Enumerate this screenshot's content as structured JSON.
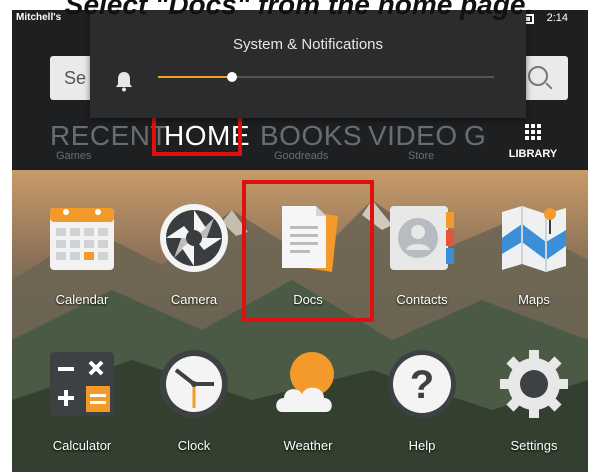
{
  "caption": "Select \"Docs\" from the home page.",
  "status_bar": {
    "owner_name": "Mitchell's",
    "time": "2:14"
  },
  "search": {
    "placeholder": "Se"
  },
  "notification": {
    "title": "System & Notifications",
    "volume_level": 0.22
  },
  "tabs": [
    {
      "label": "RECENT",
      "sub": "Games"
    },
    {
      "label": "HOME",
      "sub": ""
    },
    {
      "label": "BOOKS",
      "sub": "Goodreads"
    },
    {
      "label": "VIDEO",
      "sub": "Store"
    },
    {
      "label": "G",
      "sub": ""
    }
  ],
  "library_label": "LIBRARY",
  "apps": [
    {
      "label": "Calendar"
    },
    {
      "label": "Camera"
    },
    {
      "label": "Docs"
    },
    {
      "label": "Contacts"
    },
    {
      "label": "Maps"
    },
    {
      "label": "Calculator"
    },
    {
      "label": "Clock"
    },
    {
      "label": "Weather"
    },
    {
      "label": "Help"
    },
    {
      "label": "Settings"
    }
  ],
  "colors": {
    "highlight": "#e01010",
    "accent": "#f0a020"
  }
}
